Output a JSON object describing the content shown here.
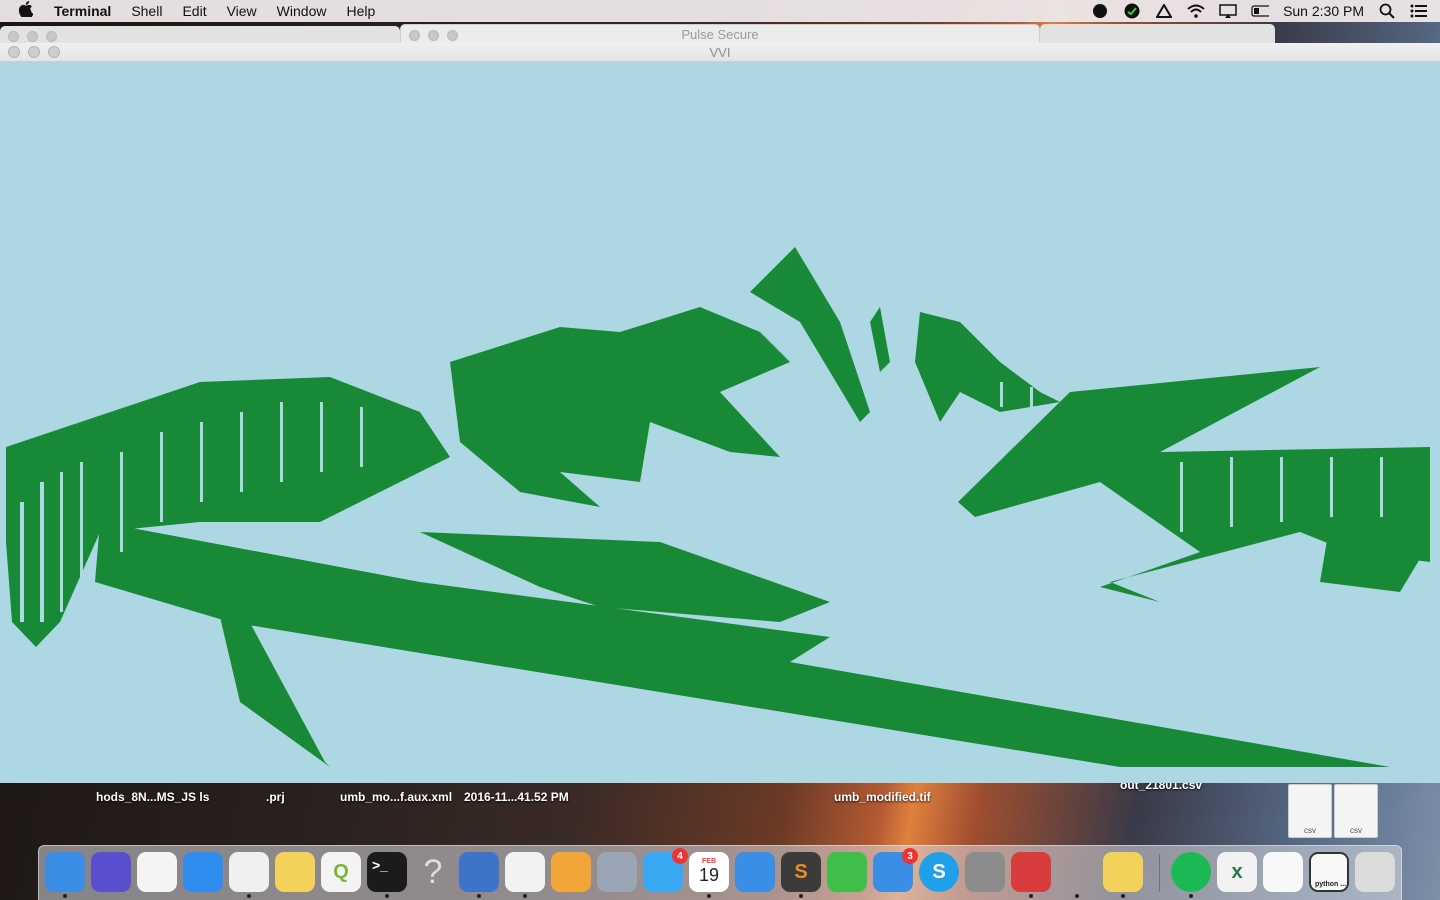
{
  "menubar": {
    "app_name": "Terminal",
    "items": [
      "Shell",
      "Edit",
      "View",
      "Window",
      "Help"
    ],
    "clock": "Sun 2:30 PM"
  },
  "background_windows": {
    "pulse_title": "Pulse Secure"
  },
  "vvi_window": {
    "title": "VVI",
    "canvas_bg": "#add8e3",
    "mesh_color": "#188a37"
  },
  "desktop": {
    "files": [
      {
        "line1": "hods_8N...MS_JS ls"
      },
      {
        "line1": ".prj"
      },
      {
        "line1": "umb_mo...f.aux.xml"
      },
      {
        "line1": "2016-11...41.52 PM"
      },
      {
        "line1": "umb_modified.tif"
      },
      {
        "line1": "out_21801.csv"
      }
    ],
    "csv_tags": [
      "csv",
      "csv"
    ]
  },
  "dock": {
    "items": [
      {
        "name": "finder",
        "color": "#3a8ee6"
      },
      {
        "name": "siri",
        "color": "#5a4fcf"
      },
      {
        "name": "google-drive",
        "color": "#f4f4f4"
      },
      {
        "name": "safari",
        "color": "#2f8df0"
      },
      {
        "name": "chrome",
        "color": "#f0f0f0"
      },
      {
        "name": "python-launcher",
        "color": "#f2d25b"
      },
      {
        "name": "qgis",
        "color": "#f3f3f3"
      },
      {
        "name": "terminal",
        "color": "#1b1b1b"
      },
      {
        "name": "unknown-app",
        "color": "transparent"
      },
      {
        "name": "google-earth",
        "color": "#3f72c9"
      },
      {
        "name": "numbers",
        "color": "#f2f2f2"
      },
      {
        "name": "pages",
        "color": "#f2a63a"
      },
      {
        "name": "preview",
        "color": "#9aa6b6"
      },
      {
        "name": "messages",
        "color": "#3aa8f3"
      },
      {
        "name": "calendar",
        "color": "#ffffff"
      },
      {
        "name": "xcode",
        "color": "#3a8ee6"
      },
      {
        "name": "sublime-text",
        "color": "#3b3b3b"
      },
      {
        "name": "facetime",
        "color": "#3fbf4a"
      },
      {
        "name": "app-store",
        "color": "#3a8ee6"
      },
      {
        "name": "skype",
        "color": "#1fa0e8"
      },
      {
        "name": "system-preferences",
        "color": "#8c8c8c"
      },
      {
        "name": "remote-desktop",
        "color": "#d93c3c"
      },
      {
        "name": "pulse-secure",
        "color": "transparent"
      },
      {
        "name": "cyberduck",
        "color": "#f2d25b"
      },
      {
        "name": "spotify",
        "color": "#1db954"
      },
      {
        "name": "excel",
        "color": "#f2f2f2"
      },
      {
        "name": "document",
        "color": "#f8f8f8"
      },
      {
        "name": "python-window",
        "color": "#f8f8f8"
      },
      {
        "name": "trash",
        "color": "#dcdcdc"
      }
    ],
    "messages_badge": "4",
    "appstore_badge": "3",
    "calendar_month": "FEB",
    "calendar_day": "19",
    "window_caption": "python ..."
  }
}
